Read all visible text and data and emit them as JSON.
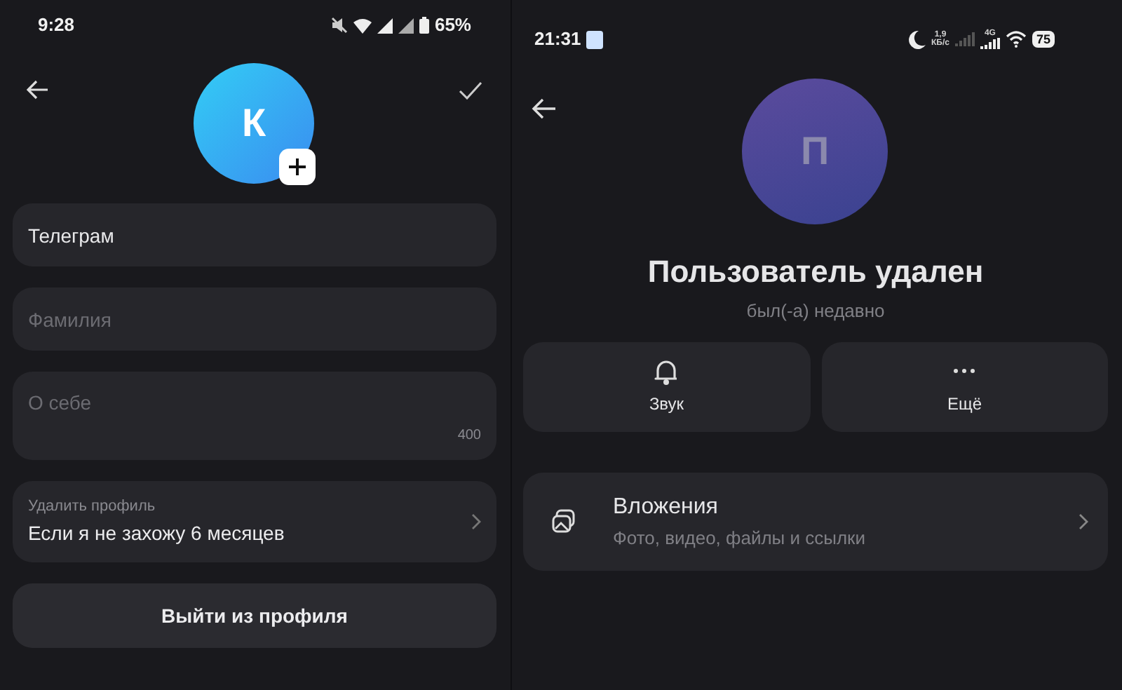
{
  "left": {
    "status_bar": {
      "time": "9:28",
      "battery": "65%"
    },
    "avatar": {
      "initial": "К"
    },
    "fields": [
      {
        "kind": "value",
        "value": "Телеграм"
      },
      {
        "kind": "placeholder",
        "placeholder": "Фамилия"
      },
      {
        "kind": "bio",
        "placeholder": "О себе",
        "counter": "400"
      }
    ],
    "delete_profile": {
      "label": "Удалить профиль",
      "value": "Если я не захожу 6 месяцев"
    },
    "logout_button": "Выйти из профиля"
  },
  "right": {
    "status_bar": {
      "time": "21:31",
      "speed": "1,9",
      "speed_unit": "КБ/с",
      "network": "4G",
      "battery": "75"
    },
    "avatar": {
      "initial": "П"
    },
    "name": "Пользователь удален",
    "last_seen": "был(-а) недавно",
    "actions": [
      {
        "kind": "bell",
        "label": "Звук"
      },
      {
        "kind": "more",
        "label": "Ещё"
      }
    ],
    "attachments": {
      "title": "Вложения",
      "subtitle": "Фото, видео, файлы и ссылки"
    }
  }
}
